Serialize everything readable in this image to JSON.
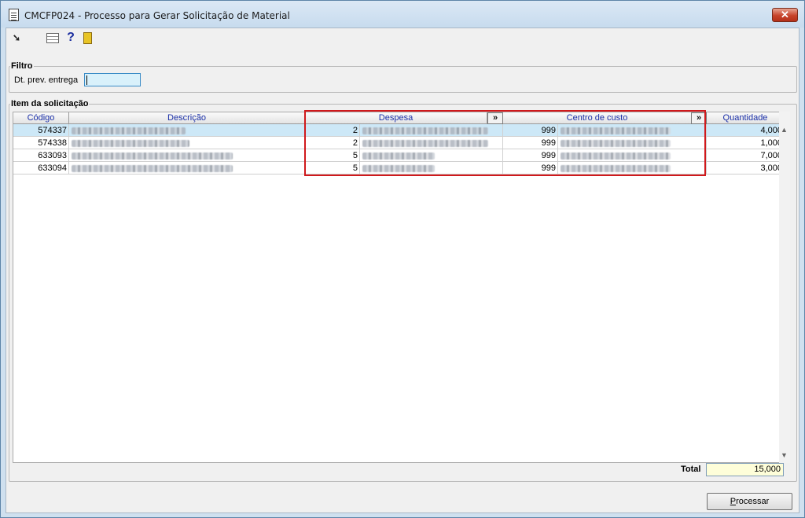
{
  "window": {
    "title": "CMCFP024 - Processo para Gerar Solicitação de Material",
    "close_label": "✕"
  },
  "toolbar": {
    "icons": [
      "arrow-icon",
      "grid-icon",
      "help-icon",
      "exit-icon"
    ],
    "help_label": "?"
  },
  "filtro": {
    "legend": "Filtro",
    "dt_label": "Dt. prev. entrega",
    "dt_value": ""
  },
  "items": {
    "legend": "Item da solicitação",
    "columns": {
      "codigo": "Código",
      "descricao": "Descrição",
      "despesa": "Despesa",
      "centro": "Centro de custo",
      "quantidade": "Quantidade",
      "expand": "»"
    },
    "rows": [
      {
        "codigo": "574337",
        "despesa": "2",
        "centro": "999",
        "quantidade": "4,000"
      },
      {
        "codigo": "574338",
        "despesa": "2",
        "centro": "999",
        "quantidade": "1,000"
      },
      {
        "codigo": "633093",
        "despesa": "5",
        "centro": "999",
        "quantidade": "7,000"
      },
      {
        "codigo": "633094",
        "despesa": "5",
        "centro": "999",
        "quantidade": "3,000"
      }
    ]
  },
  "footer": {
    "total_label": "Total",
    "total_value": "15,000",
    "processar_first": "P",
    "processar_rest": "rocessar"
  },
  "colors": {
    "highlight": "#d0191c",
    "selected_row": "#cde8f7",
    "header_text": "#1a2fa8"
  }
}
